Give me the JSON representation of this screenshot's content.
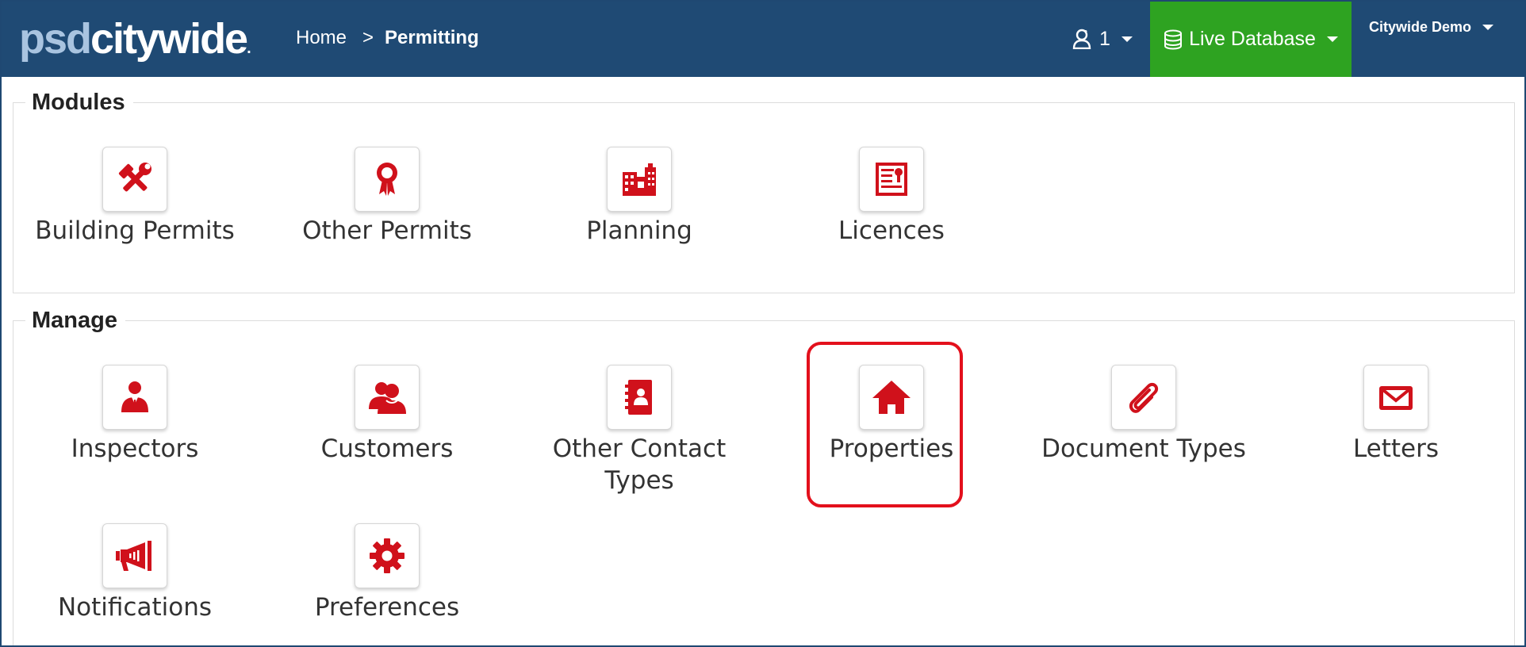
{
  "header": {
    "logo_psd": "psd",
    "logo_city": "citywide",
    "logo_dot": ".",
    "breadcrumb": {
      "home": "Home",
      "separator": ">",
      "current": "Permitting"
    },
    "users_count": "1",
    "database_label": "Live Database",
    "account_label": "Citywide Demo"
  },
  "modules": {
    "legend": "Modules",
    "items": [
      {
        "label": "Building Permits",
        "icon": "hammer-wrench-icon"
      },
      {
        "label": "Other Permits",
        "icon": "ribbon-award-icon"
      },
      {
        "label": "Planning",
        "icon": "buildings-icon"
      },
      {
        "label": "Licences",
        "icon": "certificate-icon"
      }
    ]
  },
  "manage": {
    "legend": "Manage",
    "items": [
      {
        "label": "Inspectors",
        "icon": "inspector-icon"
      },
      {
        "label": "Customers",
        "icon": "customers-icon"
      },
      {
        "label": "Other Contact Types",
        "icon": "contact-book-icon"
      },
      {
        "label": "Properties",
        "icon": "house-icon",
        "highlighted": true
      },
      {
        "label": "Document Types",
        "icon": "paperclip-icon"
      },
      {
        "label": "Letters",
        "icon": "envelope-icon"
      },
      {
        "label": "Notifications",
        "icon": "megaphone-icon"
      },
      {
        "label": "Preferences",
        "icon": "gear-icon"
      }
    ]
  },
  "colors": {
    "navbar": "#1f4a74",
    "live_database": "#2ea321",
    "icon_red": "#d0111b",
    "highlight": "#e3101c"
  }
}
